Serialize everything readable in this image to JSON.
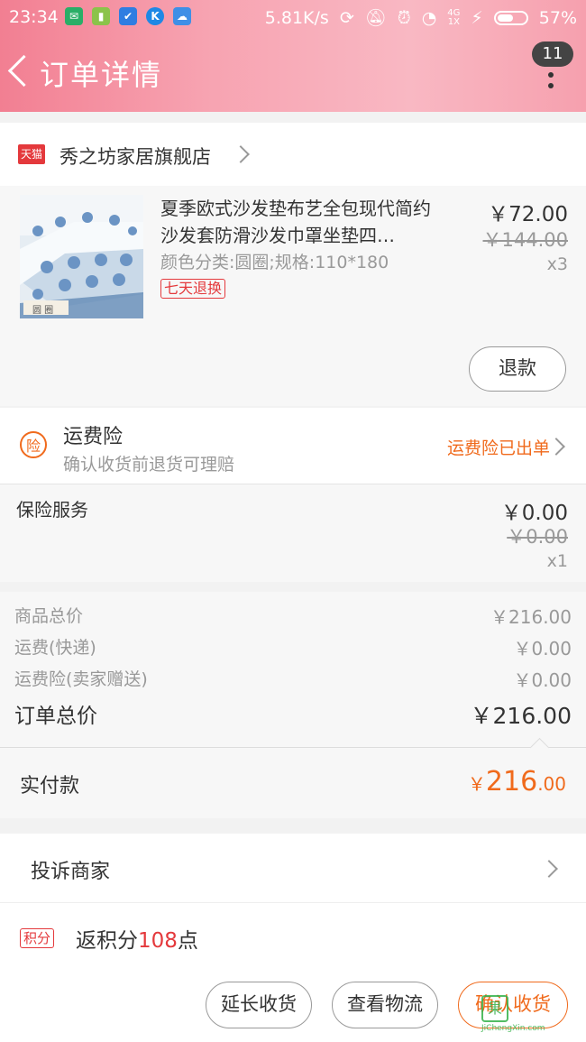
{
  "status_bar": {
    "time": "23:34",
    "speed": "5.81K/s",
    "net_top": "4G",
    "net_bottom": "1X",
    "battery": "57%",
    "battery_level": 0.57
  },
  "header": {
    "title": "订单详情",
    "badge": "11"
  },
  "shop": {
    "icon_text": "天猫",
    "name": "秀之坊家居旗舰店"
  },
  "item": {
    "thumb_text": "圆 圈",
    "title": "夏季欧式沙发垫布艺全包现代简约沙发套防滑沙发巾罩坐垫四…",
    "spec": "颜色分类:圆圈;规格:110*180",
    "tag": "七天退换",
    "price": "￥72.00",
    "original_price": "￥144.00",
    "quantity": "x3",
    "refund_label": "退款"
  },
  "shipping_insurance": {
    "icon_text": "险",
    "title": "运费险",
    "subtitle": "确认收货前退货可理赔",
    "status": "运费险已出单"
  },
  "insurance_service": {
    "title": "保险服务",
    "price": "￥0.00",
    "original_price": "￥0.00",
    "quantity": "x1"
  },
  "summary": {
    "goods_label": "商品总价",
    "goods_value": "￥216.00",
    "shipping_label": "运费(快递)",
    "shipping_value": "￥0.00",
    "insurance_label": "运费险(卖家赠送)",
    "insurance_value": "￥0.00",
    "total_label": "订单总价",
    "total_value": "￥216.00"
  },
  "paid": {
    "label": "实付款",
    "currency": "￥",
    "integer": "216",
    "decimal": ".00"
  },
  "complain": {
    "label": "投诉商家"
  },
  "points": {
    "tag": "积分",
    "prefix": "返积分",
    "value": "108",
    "suffix": "点"
  },
  "actions": {
    "extend": "延长收货",
    "logistics": "查看物流",
    "confirm": "确认收货"
  },
  "watermark": {
    "icon": "果",
    "text": "JiChengXin.com"
  },
  "colors": {
    "accent": "#f06a1c",
    "tmall_red": "#e4393c",
    "header_pink": "#f7a3b1"
  }
}
